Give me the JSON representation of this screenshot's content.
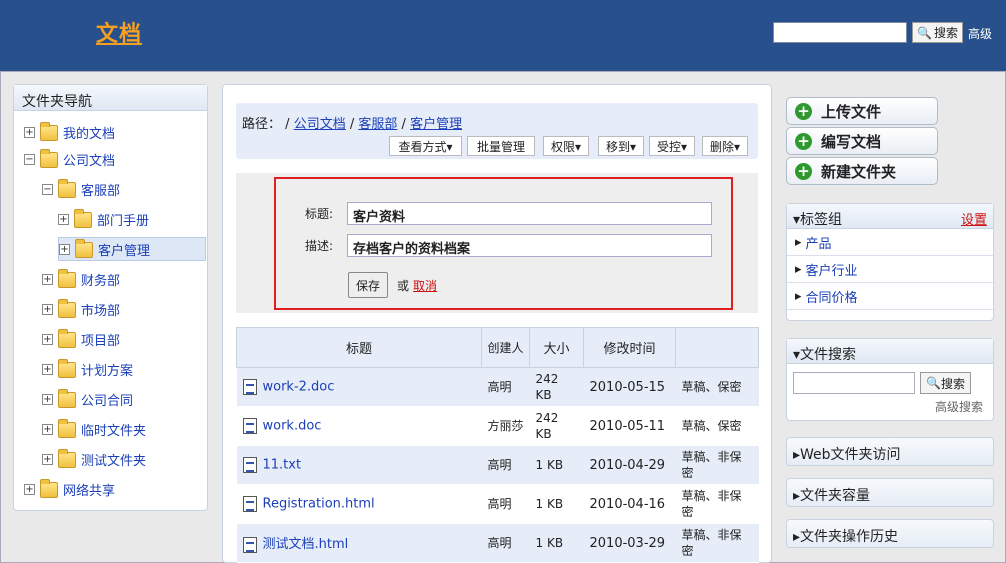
{
  "header": {
    "logo": "文档",
    "search_button": "搜索",
    "advanced": "高级"
  },
  "nav": {
    "title": "文件夹导航",
    "items": [
      {
        "label": "我的文档",
        "exp": "+"
      },
      {
        "label": "公司文档",
        "exp": "−"
      },
      {
        "label": "客服部",
        "exp": "−"
      },
      {
        "label": "部门手册",
        "exp": "+"
      },
      {
        "label": "客户管理",
        "exp": "+"
      },
      {
        "label": "财务部",
        "exp": "+"
      },
      {
        "label": "市场部",
        "exp": "+"
      },
      {
        "label": "项目部",
        "exp": "+"
      },
      {
        "label": "计划方案",
        "exp": "+"
      },
      {
        "label": "公司合同",
        "exp": "+"
      },
      {
        "label": "临时文件夹",
        "exp": "+"
      },
      {
        "label": "测试文件夹",
        "exp": "+"
      },
      {
        "label": "网络共享",
        "exp": "+"
      }
    ]
  },
  "path": {
    "prefix": "路径：",
    "sep": "/",
    "crumbs": [
      "公司文档",
      "客服部",
      "客户管理"
    ]
  },
  "toolbar": {
    "view": "查看方式▾",
    "batch": "批量管理",
    "perm": "权限▾",
    "move": "移到▾",
    "control": "受控▾",
    "delete": "删除▾"
  },
  "edit": {
    "title_label": "标题:",
    "title_value": "客户资料",
    "desc_label": "描述:",
    "desc_value": "存档客户的资料档案",
    "save": "保存",
    "or": "或",
    "cancel": "取消"
  },
  "table": {
    "headers": [
      "标题",
      "创建人",
      "大小",
      "修改时间",
      ""
    ],
    "rows": [
      {
        "name": "work-2.doc",
        "creator": "高明",
        "size": "242 KB",
        "date": "2010-05-15",
        "status": "草稿、保密"
      },
      {
        "name": "work.doc",
        "creator": "方丽莎",
        "size": "242 KB",
        "date": "2010-05-11",
        "status": "草稿、保密"
      },
      {
        "name": "11.txt",
        "creator": "高明",
        "size": "1 KB",
        "date": "2010-04-29",
        "status": "草稿、非保密"
      },
      {
        "name": "Registration.html",
        "creator": "高明",
        "size": "1 KB",
        "date": "2010-04-16",
        "status": "草稿、非保密"
      },
      {
        "name": "测试文档.html",
        "creator": "高明",
        "size": "1 KB",
        "date": "2010-03-29",
        "status": "草稿、非保密"
      }
    ]
  },
  "actions": {
    "upload": "上传文件",
    "write": "编写文档",
    "newfolder": "新建文件夹"
  },
  "tags": {
    "title": "▾标签组",
    "settings": "设置",
    "items": [
      "产品",
      "客户行业",
      "合同价格"
    ]
  },
  "filesearch": {
    "title": "▾文件搜索",
    "button": "搜索",
    "advanced": "高级搜索"
  },
  "collapsibles": [
    "▸Web文件夹访问",
    "▸文件夹容量",
    "▸文件夹操作历史"
  ]
}
